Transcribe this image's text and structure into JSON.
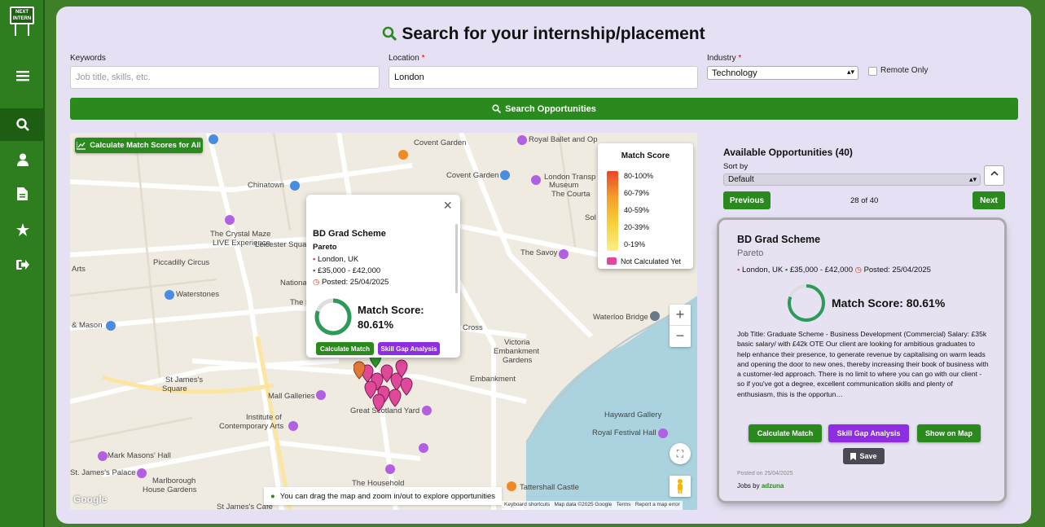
{
  "app": {
    "logo_text": "NEXT INTERN"
  },
  "sidebar": {
    "items": [
      {
        "icon": "menu-icon"
      },
      {
        "icon": "search-icon",
        "active": true
      },
      {
        "icon": "user-icon"
      },
      {
        "icon": "document-icon"
      },
      {
        "icon": "star-icon"
      },
      {
        "icon": "logout-icon"
      }
    ]
  },
  "header": {
    "title": "Search for your internship/placement"
  },
  "form": {
    "keywords_label": "Keywords",
    "keywords_placeholder": "Job title, skills, etc.",
    "location_label": "Location",
    "location_value": "London",
    "industry_label": "Industry",
    "industry_value": "Technology",
    "required_mark": "*",
    "remote_label": "Remote Only",
    "search_button": "Search Opportunities"
  },
  "map": {
    "calc_all_button": "Calculate Match Scores for All",
    "labels": [
      "Covent Garden",
      "Royal Ballet and Op",
      "Covent Garden",
      "London Transp",
      "Museum",
      "The Courta",
      "Chinatown",
      "The Crystal Maze",
      "LIVE Experience",
      "Leicester Squar",
      "Piccadilly Circus",
      "Arts",
      "The Savoy",
      "Waterstones",
      "Nationa",
      "The N",
      "Waterloo Bridge",
      "& Mason",
      "Cross",
      "Victoria",
      "Embankment",
      "Gardens",
      "Embankment",
      "St James's",
      "Square",
      "Mall Galleries",
      "Institute of",
      "Contemporary Arts",
      "Great Scotland Yard",
      "Hayward Gallery",
      "Royal Festival Hall",
      "Mark Masons' Hall",
      "St. James's Palace",
      "Marlborough",
      "House Gardens",
      "The Household",
      "Tattershall Castle",
      "St James's Cafe",
      "Sol"
    ],
    "hint": "You can drag the map and zoom in/out to explore opportunities",
    "attribution": [
      "Keyboard shortcuts",
      "Map data ©2025 Google",
      "Terms",
      "Report a map error"
    ],
    "google_logo": "Google",
    "zoom_in": "+",
    "zoom_out": "−"
  },
  "popup": {
    "title": "BD Grad Scheme",
    "company": "Pareto",
    "location": "London, UK",
    "salary": "£35,000 - £42,000",
    "posted": "Posted: 25/04/2025",
    "match_label": "Match Score:",
    "match_value": "80.61%",
    "match_fraction": 0.8061,
    "calc_button": "Calculate Match",
    "skill_button": "Skill Gap Analysis",
    "close": "×"
  },
  "legend": {
    "title": "Match Score",
    "ranges": [
      "80-100%",
      "60-79%",
      "40-59%",
      "20-39%",
      "0-19%"
    ],
    "not_calc": "Not Calculated Yet",
    "not_calc_color": "#e0489a"
  },
  "results": {
    "title": "Available Opportunities (40)",
    "sort_label": "Sort by",
    "sort_value": "Default",
    "prev": "Previous",
    "next": "Next",
    "pager": "28 of 40"
  },
  "card": {
    "title": "BD Grad Scheme",
    "company": "Pareto",
    "location": "London, UK",
    "salary": "£35,000 - £42,000",
    "posted": "Posted: 25/04/2025",
    "match_text": "Match Score: 80.61%",
    "match_fraction": 0.8061,
    "description": "Job Title: Graduate Scheme - Business Development (Commercial) Salary: £35k basic salary/ with £42k OTE Our client are looking for ambitious graduates to help enhance their presence, to generate revenue by capitalising on warm leads and opening the door to new ones, thereby increasing their book of business with a customer-led approach. There is no limit to where you can go with our client - so if you've got a degree, excellent communication skills and plenty of enthusiasm, this is the opportun…",
    "calc_button": "Calculate Match",
    "skill_button": "Skill Gap Analysis",
    "map_button": "Show on Map",
    "save_button": "Save",
    "posted_on": "Posted on 25/04/2025",
    "jobs_by": "Jobs by",
    "provider": "adzuna"
  },
  "colors": {
    "green": "#2a8a1d",
    "purple": "#8e2de2",
    "panel": "#e5e0f3"
  }
}
